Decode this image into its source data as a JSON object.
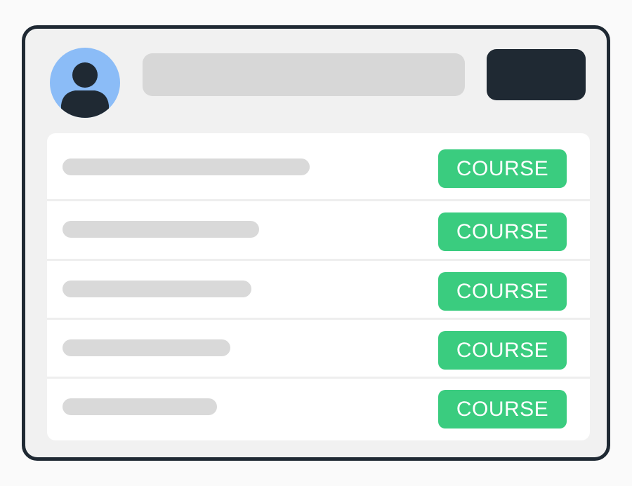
{
  "colors": {
    "window_border": "#1f2933",
    "window_background": "#f1f1f1",
    "avatar_background": "#8bbcf7",
    "avatar_figure": "#1f2933",
    "placeholder": "#d7d7d7",
    "dark_button": "#1f2933",
    "course_button": "#3acc7f",
    "course_button_text": "#ffffff"
  },
  "header": {
    "avatar_icon": "user-avatar-icon",
    "search_bar_text": "",
    "action_button_label": ""
  },
  "courses": [
    {
      "title": "",
      "action_label": "COURSE"
    },
    {
      "title": "",
      "action_label": "COURSE"
    },
    {
      "title": "",
      "action_label": "COURSE"
    },
    {
      "title": "",
      "action_label": "COURSE"
    },
    {
      "title": "",
      "action_label": "COURSE"
    }
  ]
}
